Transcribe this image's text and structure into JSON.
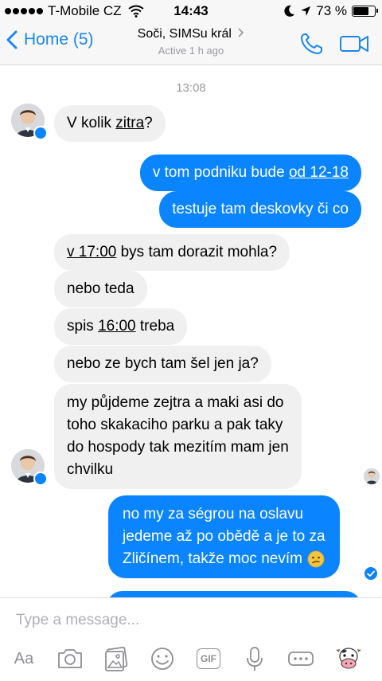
{
  "status_bar": {
    "carrier": "T-Mobile CZ",
    "time": "14:43",
    "battery_percent": "73 %",
    "battery_level": 0.73,
    "icons": [
      "signal-dots-icon",
      "wifi-icon",
      "moon-icon",
      "location-arrow-icon",
      "battery-icon"
    ]
  },
  "nav": {
    "back_label": "Home (5)",
    "title": "Soči, SIMSu král",
    "subtitle": "Active 1 h ago",
    "icons": [
      "chevron-left-icon",
      "chevron-right-icon",
      "phone-icon",
      "video-camera-icon"
    ]
  },
  "chat": {
    "timestamp": "13:08",
    "messages": [
      {
        "dir": "in",
        "parts": [
          "V kolik ",
          "zitra",
          "?"
        ]
      },
      {
        "dir": "out",
        "parts": [
          "v tom podniku bude ",
          "od 12-18"
        ]
      },
      {
        "dir": "out",
        "parts": [
          "testuje tam deskovky či co"
        ]
      },
      {
        "dir": "in",
        "parts": [
          "v 17:00",
          " bys tam dorazit mohla?"
        ]
      },
      {
        "dir": "in",
        "parts": [
          "nebo teda"
        ]
      },
      {
        "dir": "in",
        "parts": [
          "spis ",
          "16:00",
          " treba"
        ]
      },
      {
        "dir": "in",
        "parts": [
          "nebo ze bych tam šel jen ja?"
        ]
      },
      {
        "dir": "in",
        "lines": [
          "my půjdeme zejtra a maki asi do",
          "toho skakaciho parku a pak taky",
          "do hospody tak mezitím mam jen",
          "chvilku"
        ]
      },
      {
        "dir": "out",
        "lines": [
          "no my za ségrou na oslavu",
          "jedeme až po obědě a je to za",
          "Zličínem, takže moc nevím"
        ],
        "emoji": "confused-face-emoji"
      }
    ]
  },
  "composer": {
    "placeholder": "Type a message...",
    "aa_label": "Aa",
    "gif_label": "GIF",
    "tools": [
      "text-format-icon",
      "camera-icon",
      "photo-gallery-icon",
      "emoji-smiley-icon",
      "gif-icon",
      "microphone-icon",
      "more-icon",
      "cow-sticker-icon"
    ]
  },
  "colors": {
    "accent": "#0a84ff",
    "incoming_bubble": "#f1f0f0",
    "nav_link": "#1a86f0",
    "muted_text": "#9a9aa0"
  }
}
